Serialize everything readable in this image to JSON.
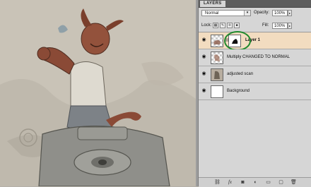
{
  "panel": {
    "tab_label": "LAYERS",
    "blend_mode": "Normal",
    "opacity_label": "Opacity:",
    "opacity_value": "100%",
    "lock_label": "Lock:",
    "fill_label": "Fill:",
    "fill_value": "100%"
  },
  "layers": [
    {
      "name": "Layer 1",
      "selected": true,
      "visible": true,
      "has_mask": true
    },
    {
      "name": "Multiply CHANGED TO NORMAL",
      "selected": false,
      "visible": true
    },
    {
      "name": "adjusted scan",
      "selected": false,
      "visible": true
    },
    {
      "name": "Background",
      "selected": false,
      "visible": true
    }
  ],
  "bottom_icons": [
    "link-icon",
    "fx-icon",
    "mask-icon",
    "adjustment-icon",
    "folder-icon",
    "new-layer-icon",
    "trash-icon"
  ],
  "colors": {
    "selection": "#f2dcc0",
    "annotation_circle": "#1f8a2e",
    "panel_bg": "#d6d6d6"
  }
}
